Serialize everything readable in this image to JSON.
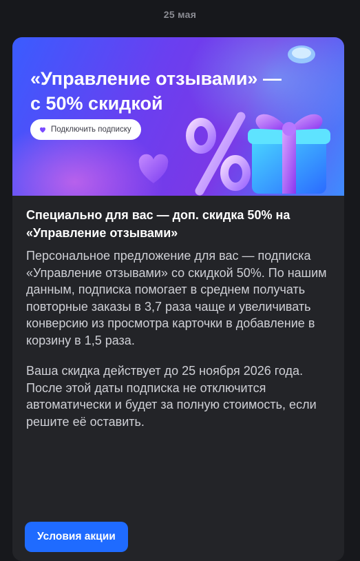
{
  "date": "25 мая",
  "banner": {
    "title": "«Управление отзывами» — с 50% скидкой",
    "pill_label": "Подключить подписку",
    "percent_symbol": "%",
    "icons": [
      "heart-icon",
      "percent-icon",
      "gift-box-icon",
      "coin-icon"
    ]
  },
  "message": {
    "headline": "Специально для вас — доп. скидка 50% на «Управление отзывами»",
    "paragraph1": "Персональное предложение для вас — подписка «Управление отзывами» со скидкой 50%. По нашим данным, подписка помогает в среднем получать повторные заказы в 3,7 раза чаще и увеличивать конверсию из просмотра карточки в добавление в корзину в 1,5 раза.",
    "paragraph2": "Ваша скидка действует до 25 ноября 2026 года. После этой даты подписка не отключится автоматически и будет за полную стоимость, если решите её оставить."
  },
  "cta_label": "Условия акции",
  "colors": {
    "background": "#17181c",
    "card": "#232428",
    "accent": "#1f6bff",
    "banner_start": "#3a5cff",
    "banner_mid": "#7b38e6"
  }
}
